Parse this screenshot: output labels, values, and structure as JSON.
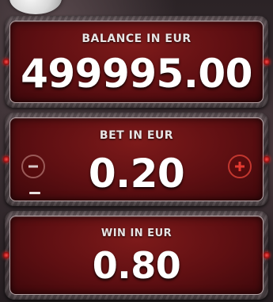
{
  "balance": {
    "label": "BALANCE IN EUR",
    "value": "499995.00"
  },
  "bet": {
    "label": "BET IN EUR",
    "value": "0.20"
  },
  "win": {
    "label": "WIN IN EUR",
    "value": "0.80"
  },
  "colors": {
    "panel": "#5e0f12",
    "accent": "#c2372f",
    "text": "#ffffff"
  },
  "icons": {
    "decrease": "minus-circle-icon",
    "increase": "plus-circle-icon"
  }
}
